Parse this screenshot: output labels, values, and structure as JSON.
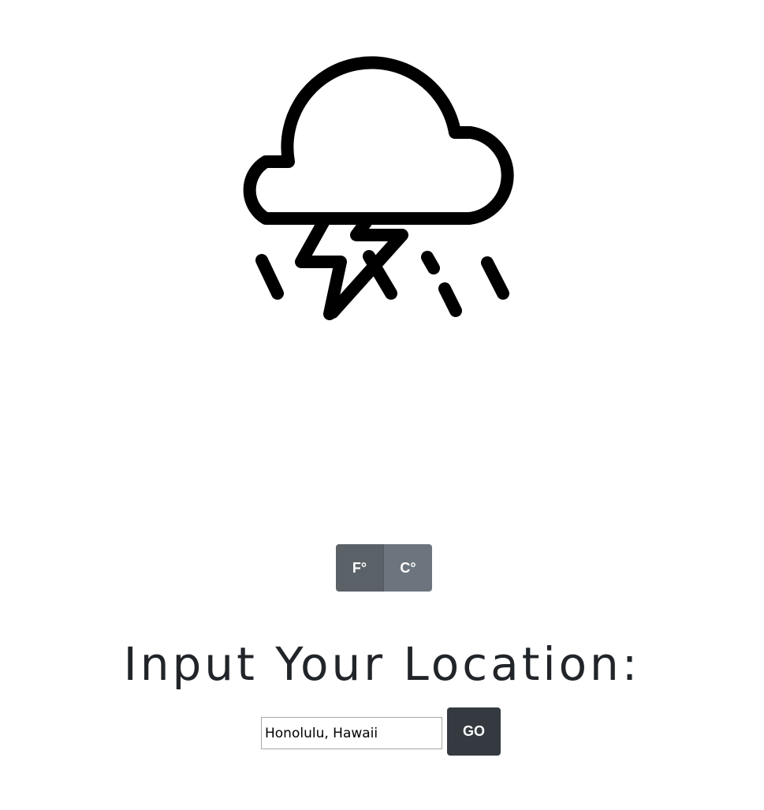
{
  "weather": {
    "icon": "thunderstorm-rain-icon"
  },
  "units": {
    "fahrenheit_label": "F°",
    "celsius_label": "C°",
    "selected": "F°"
  },
  "location": {
    "heading": "Input Your Location:",
    "input_value": "Honolulu, Hawaii",
    "go_label": "GO"
  },
  "colors": {
    "active_unit": "#5a6268",
    "inactive_unit": "#6c757d",
    "go_button": "#343a40",
    "icon_stroke": "#000000"
  }
}
